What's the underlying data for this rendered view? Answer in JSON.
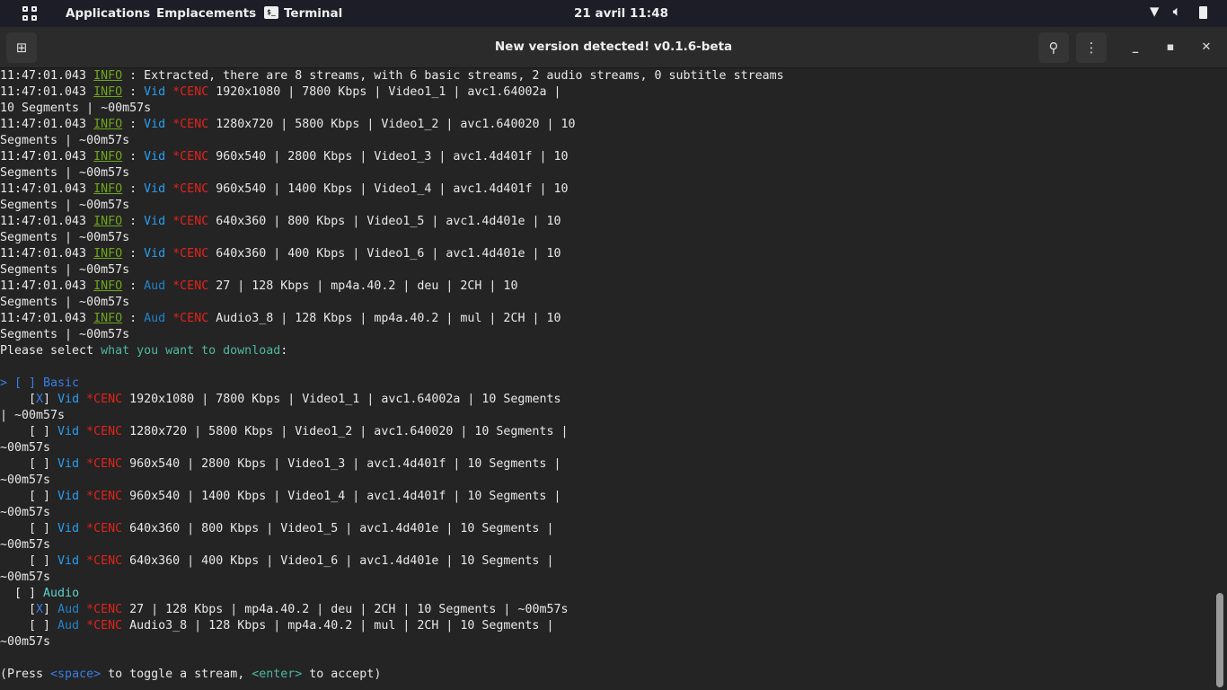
{
  "topbar": {
    "applications": "Applications",
    "places": "Emplacements",
    "terminal": "Terminal",
    "clock": "21 avril  11:48"
  },
  "window": {
    "title": "New version detected! v0.1.6-beta"
  },
  "colors": {
    "info": "#6ea51d",
    "vid": "#2a9ff0",
    "cenc": "#e2231a",
    "prompt": "#4fb8a0"
  },
  "lines": [
    [
      [
        "11:47:01.043 ",
        ""
      ],
      [
        "INFO",
        "info"
      ],
      [
        " : Extracted, there are 8 streams, with 6 basic streams, 2 audio streams, 0 subtitle streams",
        ""
      ]
    ],
    [
      [
        "11:47:01.043 ",
        ""
      ],
      [
        "INFO",
        "info"
      ],
      [
        " : ",
        ""
      ],
      [
        "Vid ",
        "vid"
      ],
      [
        "*CENC ",
        "cenc"
      ],
      [
        "1920x1080 | 7800 Kbps | Video1_1 | avc1.64002a |",
        ""
      ]
    ],
    [
      [
        "10 Segments | ~00m57s",
        ""
      ]
    ],
    [
      [
        "11:47:01.043 ",
        ""
      ],
      [
        "INFO",
        "info"
      ],
      [
        " : ",
        ""
      ],
      [
        "Vid ",
        "vid"
      ],
      [
        "*CENC ",
        "cenc"
      ],
      [
        "1280x720 | 5800 Kbps | Video1_2 | avc1.640020 | 10",
        ""
      ]
    ],
    [
      [
        "Segments | ~00m57s",
        ""
      ]
    ],
    [
      [
        "11:47:01.043 ",
        ""
      ],
      [
        "INFO",
        "info"
      ],
      [
        " : ",
        ""
      ],
      [
        "Vid ",
        "vid"
      ],
      [
        "*CENC ",
        "cenc"
      ],
      [
        "960x540 | 2800 Kbps | Video1_3 | avc1.4d401f | 10",
        ""
      ]
    ],
    [
      [
        "Segments | ~00m57s",
        ""
      ]
    ],
    [
      [
        "11:47:01.043 ",
        ""
      ],
      [
        "INFO",
        "info"
      ],
      [
        " : ",
        ""
      ],
      [
        "Vid ",
        "vid"
      ],
      [
        "*CENC ",
        "cenc"
      ],
      [
        "960x540 | 1400 Kbps | Video1_4 | avc1.4d401f | 10",
        ""
      ]
    ],
    [
      [
        "Segments | ~00m57s",
        ""
      ]
    ],
    [
      [
        "11:47:01.043 ",
        ""
      ],
      [
        "INFO",
        "info"
      ],
      [
        " : ",
        ""
      ],
      [
        "Vid ",
        "vid"
      ],
      [
        "*CENC ",
        "cenc"
      ],
      [
        "640x360 | 800 Kbps | Video1_5 | avc1.4d401e | 10",
        ""
      ]
    ],
    [
      [
        "Segments | ~00m57s",
        ""
      ]
    ],
    [
      [
        "11:47:01.043 ",
        ""
      ],
      [
        "INFO",
        "info"
      ],
      [
        " : ",
        ""
      ],
      [
        "Vid ",
        "vid"
      ],
      [
        "*CENC ",
        "cenc"
      ],
      [
        "640x360 | 400 Kbps | Video1_6 | avc1.4d401e | 10",
        ""
      ]
    ],
    [
      [
        "Segments | ~00m57s",
        ""
      ]
    ],
    [
      [
        "11:47:01.043 ",
        ""
      ],
      [
        "INFO",
        "info"
      ],
      [
        " : ",
        ""
      ],
      [
        "Aud ",
        "aud"
      ],
      [
        "*CENC ",
        "cenc"
      ],
      [
        "27 | 128 Kbps | mp4a.40.2 | deu | 2CH | 10",
        ""
      ]
    ],
    [
      [
        "Segments | ~00m57s",
        ""
      ]
    ],
    [
      [
        "11:47:01.043 ",
        ""
      ],
      [
        "INFO",
        "info"
      ],
      [
        " : ",
        ""
      ],
      [
        "Aud ",
        "aud"
      ],
      [
        "*CENC ",
        "cenc"
      ],
      [
        "Audio3_8 | 128 Kbps | mp4a.40.2 | mul | 2CH | 10",
        ""
      ]
    ],
    [
      [
        "Segments | ~00m57s",
        ""
      ]
    ],
    [
      [
        "Please select ",
        ""
      ],
      [
        "what you want to download",
        "teal"
      ],
      [
        ":",
        ""
      ]
    ],
    [],
    [
      [
        "> [ ] Basic",
        "blue"
      ]
    ],
    [
      [
        "    [",
        ""
      ],
      [
        "X",
        "blue"
      ],
      [
        "] ",
        ""
      ],
      [
        "Vid ",
        "vid"
      ],
      [
        "*CENC ",
        "cenc"
      ],
      [
        "1920x1080 | 7800 Kbps | Video1_1 | avc1.64002a | 10 Segments",
        ""
      ]
    ],
    [
      [
        "| ~00m57s",
        ""
      ]
    ],
    [
      [
        "    [ ] ",
        ""
      ],
      [
        "Vid ",
        "vid"
      ],
      [
        "*CENC ",
        "cenc"
      ],
      [
        "1280x720 | 5800 Kbps | Video1_2 | avc1.640020 | 10 Segments |",
        ""
      ]
    ],
    [
      [
        "~00m57s",
        ""
      ]
    ],
    [
      [
        "    [ ] ",
        ""
      ],
      [
        "Vid ",
        "vid"
      ],
      [
        "*CENC ",
        "cenc"
      ],
      [
        "960x540 | 2800 Kbps | Video1_3 | avc1.4d401f | 10 Segments |",
        ""
      ]
    ],
    [
      [
        "~00m57s",
        ""
      ]
    ],
    [
      [
        "    [ ] ",
        ""
      ],
      [
        "Vid ",
        "vid"
      ],
      [
        "*CENC ",
        "cenc"
      ],
      [
        "960x540 | 1400 Kbps | Video1_4 | avc1.4d401f | 10 Segments |",
        ""
      ]
    ],
    [
      [
        "~00m57s",
        ""
      ]
    ],
    [
      [
        "    [ ] ",
        ""
      ],
      [
        "Vid ",
        "vid"
      ],
      [
        "*CENC ",
        "cenc"
      ],
      [
        "640x360 | 800 Kbps | Video1_5 | avc1.4d401e | 10 Segments |",
        ""
      ]
    ],
    [
      [
        "~00m57s",
        ""
      ]
    ],
    [
      [
        "    [ ] ",
        ""
      ],
      [
        "Vid ",
        "vid"
      ],
      [
        "*CENC ",
        "cenc"
      ],
      [
        "640x360 | 400 Kbps | Video1_6 | avc1.4d401e | 10 Segments |",
        ""
      ]
    ],
    [
      [
        "~00m57s",
        ""
      ]
    ],
    [
      [
        "  [ ] ",
        ""
      ],
      [
        "Audio",
        "cyan"
      ]
    ],
    [
      [
        "    [",
        ""
      ],
      [
        "X",
        "blue"
      ],
      [
        "] ",
        ""
      ],
      [
        "Aud ",
        "aud"
      ],
      [
        "*CENC ",
        "cenc"
      ],
      [
        "27 | 128 Kbps | mp4a.40.2 | deu | 2CH | 10 Segments | ~00m57s",
        ""
      ]
    ],
    [
      [
        "    [ ] ",
        ""
      ],
      [
        "Aud ",
        "aud"
      ],
      [
        "*CENC ",
        "cenc"
      ],
      [
        "Audio3_8 | 128 Kbps | mp4a.40.2 | mul | 2CH | 10 Segments |",
        ""
      ]
    ],
    [
      [
        "~00m57s",
        ""
      ]
    ],
    [],
    [
      [
        "(Press ",
        ""
      ],
      [
        "<space>",
        "blue"
      ],
      [
        " to toggle a stream, ",
        ""
      ],
      [
        "<enter>",
        "teal"
      ],
      [
        " to accept)",
        ""
      ]
    ]
  ]
}
